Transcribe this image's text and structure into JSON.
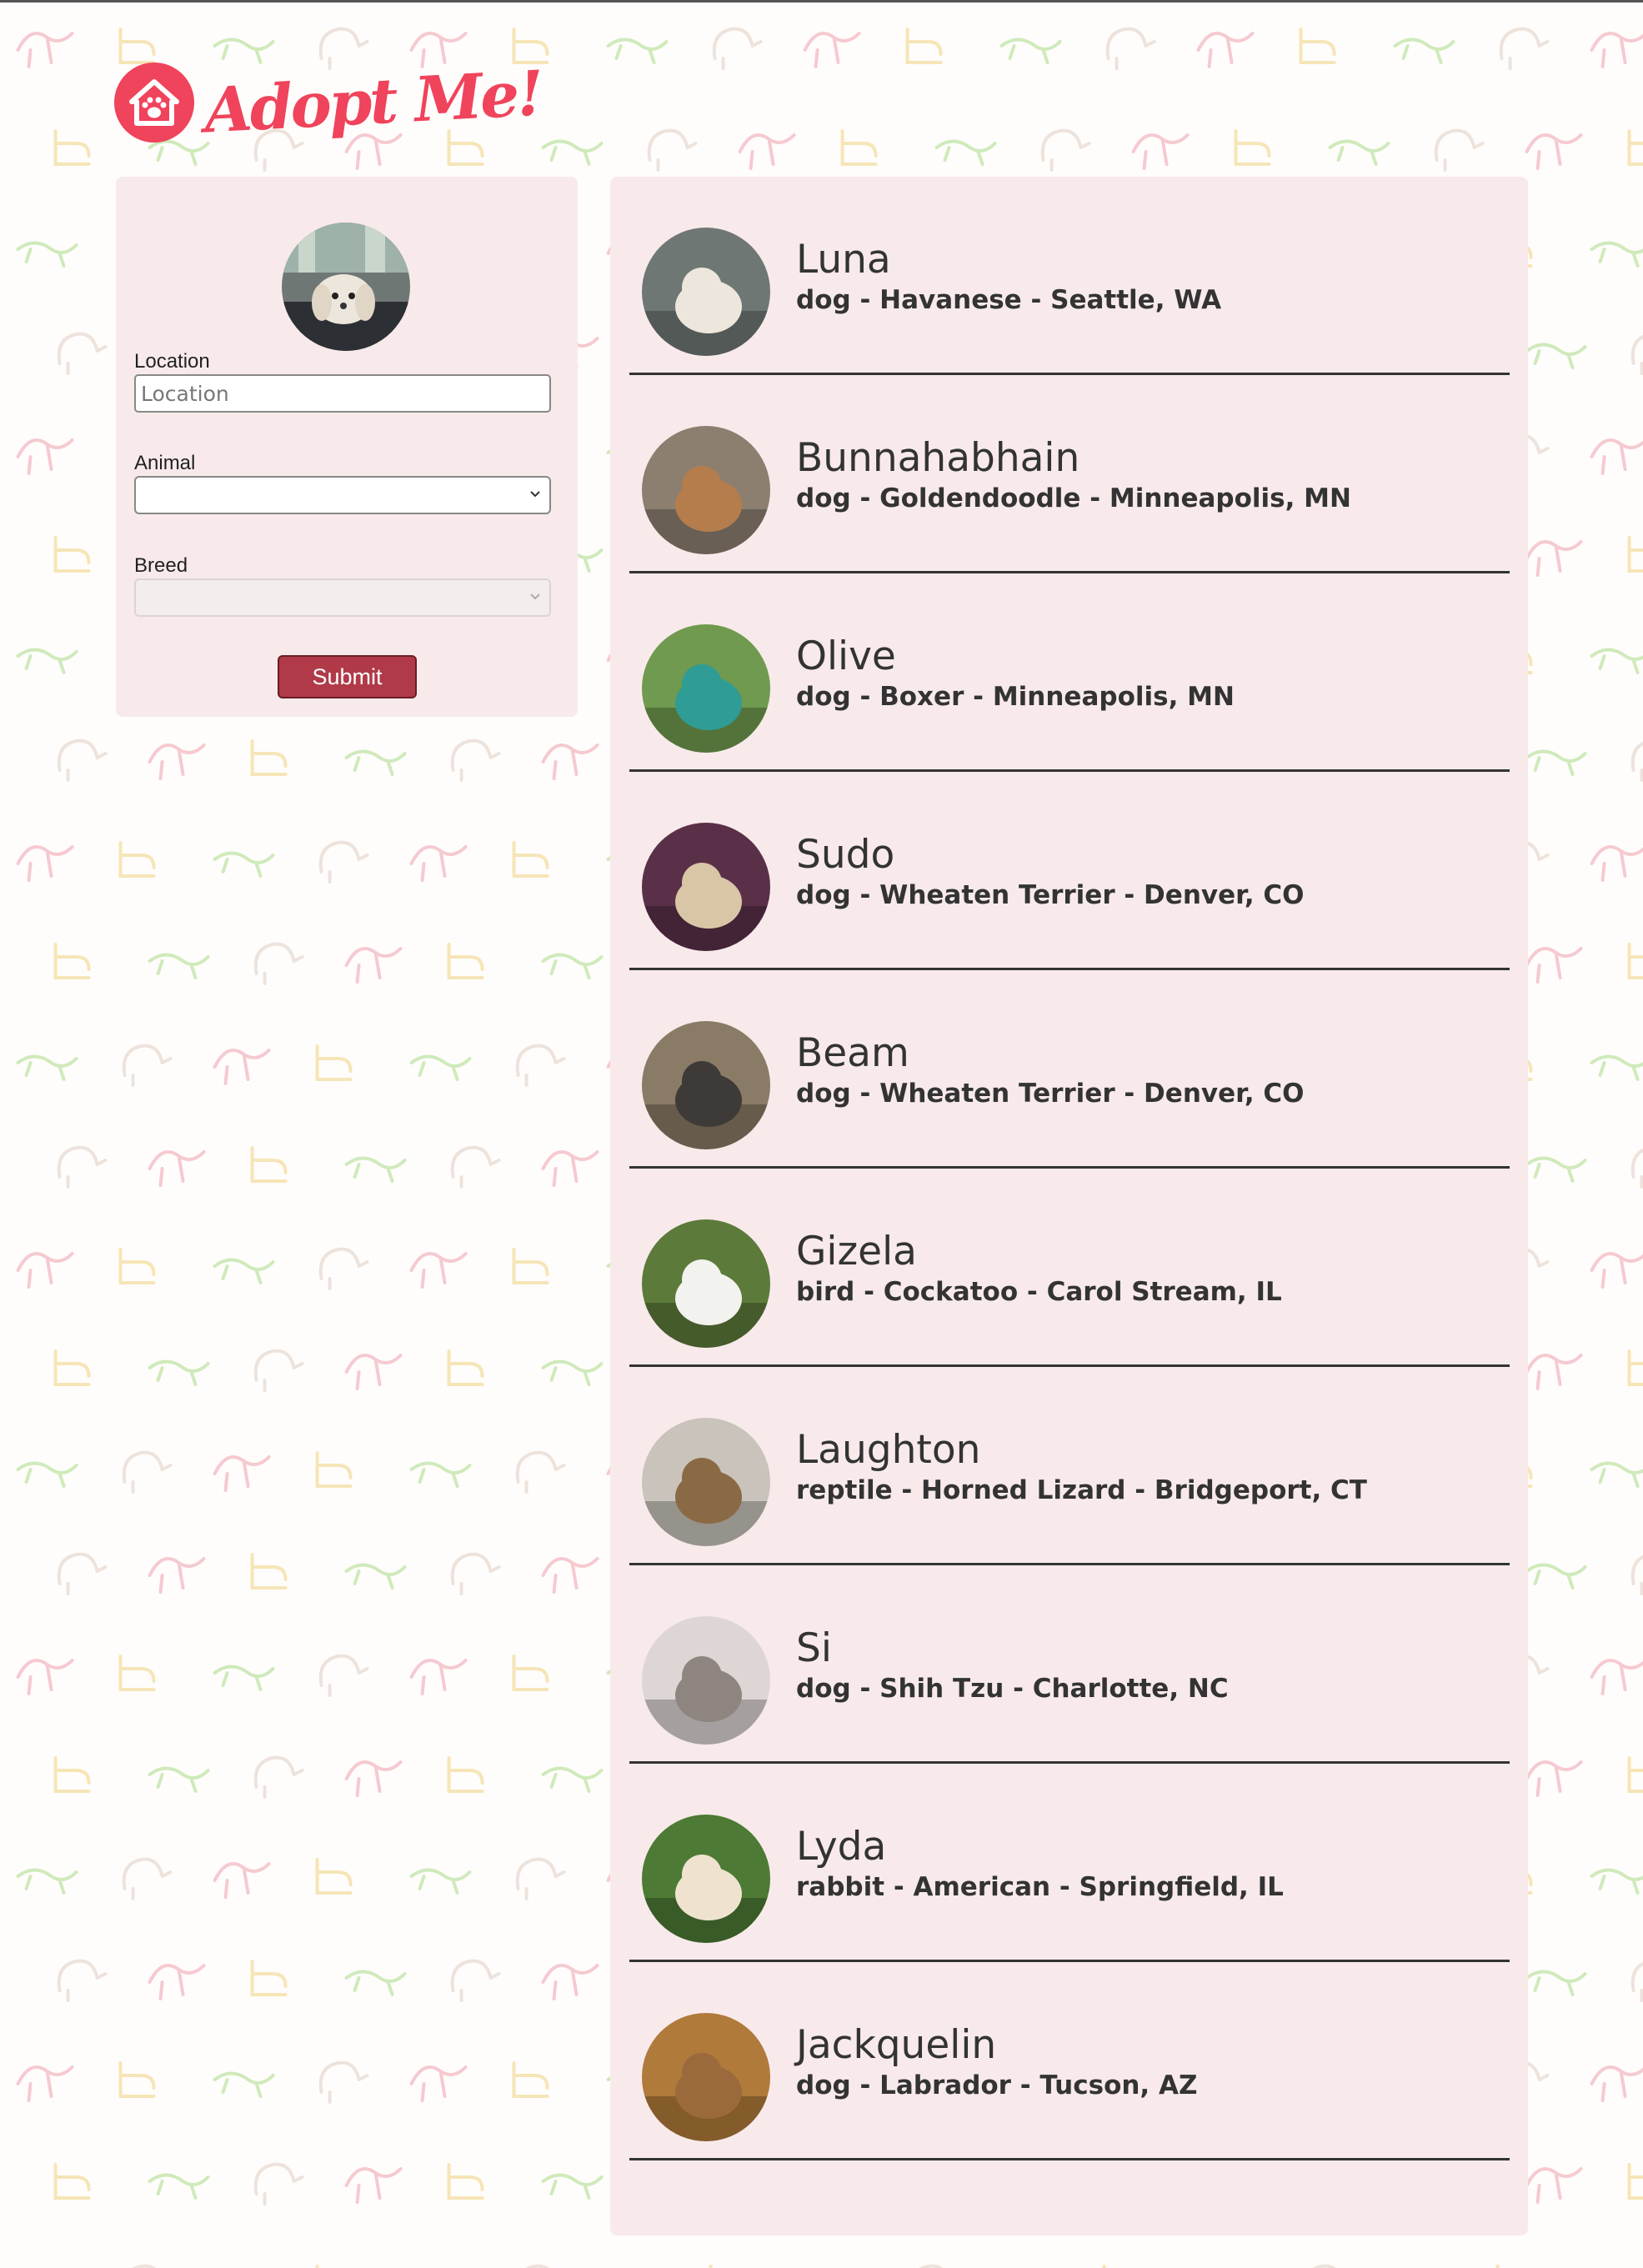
{
  "brand": {
    "title": "Adopt Me!",
    "color": "#f0435c"
  },
  "search": {
    "location_label": "Location",
    "location_placeholder": "Location",
    "animal_label": "Animal",
    "animal_value": "",
    "breed_label": "Breed",
    "breed_value": "",
    "submit_label": "Submit"
  },
  "pets": [
    {
      "name": "Luna",
      "description": "dog - Havanese - Seattle, WA",
      "photo": {
        "bg": "#6f7775",
        "subject": "#ece6dc"
      }
    },
    {
      "name": "Bunnahabhain",
      "description": "dog - Goldendoodle - Minneapolis, MN",
      "photo": {
        "bg": "#8c7f70",
        "subject": "#b57d4c"
      }
    },
    {
      "name": "Olive",
      "description": "dog - Boxer - Minneapolis, MN",
      "photo": {
        "bg": "#6f9a4f",
        "subject": "#2f9c96"
      }
    },
    {
      "name": "Sudo",
      "description": "dog - Wheaten Terrier - Denver, CO",
      "photo": {
        "bg": "#5a3048",
        "subject": "#d8c6a6"
      }
    },
    {
      "name": "Beam",
      "description": "dog - Wheaten Terrier - Denver, CO",
      "photo": {
        "bg": "#8a7b66",
        "subject": "#3e3a38"
      }
    },
    {
      "name": "Gizela",
      "description": "bird - Cockatoo - Carol Stream, IL",
      "photo": {
        "bg": "#5c7a3a",
        "subject": "#f2f2ee"
      }
    },
    {
      "name": "Laughton",
      "description": "reptile - Horned Lizard - Bridgeport, CT",
      "photo": {
        "bg": "#c9c3bb",
        "subject": "#8a6a44"
      }
    },
    {
      "name": "Si",
      "description": "dog - Shih Tzu - Charlotte, NC",
      "photo": {
        "bg": "#ddd6d4",
        "subject": "#8e8580"
      }
    },
    {
      "name": "Lyda",
      "description": "rabbit - American - Springfield, IL",
      "photo": {
        "bg": "#4d7a34",
        "subject": "#efe3d0"
      }
    },
    {
      "name": "Jackquelin",
      "description": "dog - Labrador - Tucson, AZ",
      "photo": {
        "bg": "#b07a3a",
        "subject": "#9b6a3c"
      }
    }
  ],
  "icons": {
    "logo": "house-paw-icon",
    "select": "chevron-down-icon"
  },
  "colors": {
    "panel": "#f8eaeb",
    "submit": "#b03a48",
    "pattern": [
      "#f2b8c2",
      "#f3dca0",
      "#bfe3a6",
      "#e7d9d2"
    ]
  }
}
